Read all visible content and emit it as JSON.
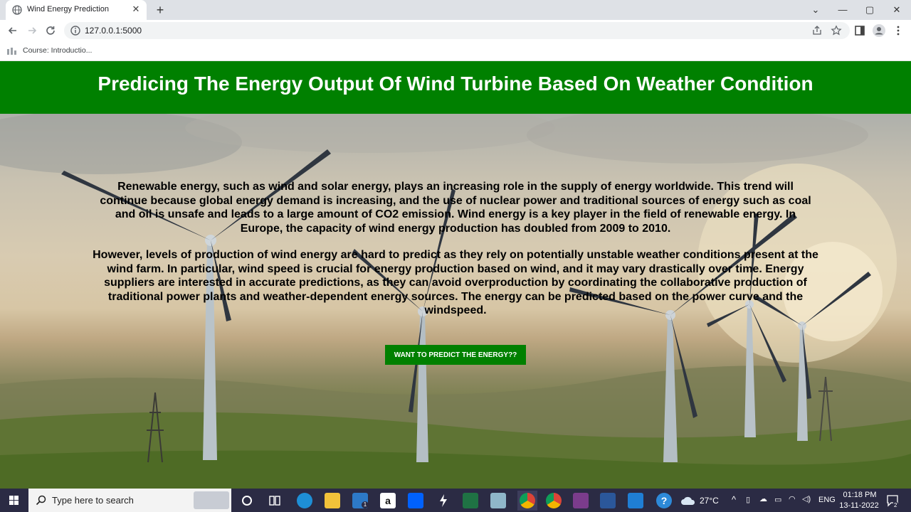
{
  "browser": {
    "tab_title": "Wind Energy Prediction",
    "url": "127.0.0.1:5000",
    "bookmark": "Course: Introductio..."
  },
  "page": {
    "title": "Predicing The Energy Output Of Wind Turbine Based On Weather Condition",
    "paragraph1": "Renewable energy, such as wind and solar energy, plays an increasing role in the supply of energy worldwide. This trend will continue because global energy demand is increasing, and the use of nuclear power and traditional sources of energy such as coal and oil is unsafe and leads to a large amount of CO2 emission. Wind energy is a key player in the field of renewable energy. In Europe, the capacity of wind energy production has doubled from 2009 to 2010.",
    "paragraph2": "However, levels of production of wind energy are hard to predict as they rely on potentially unstable weather conditions present at the wind farm. In particular, wind speed is crucial for energy production based on wind, and it may vary drastically over time. Energy suppliers are interested in accurate predictions, as they can avoid overproduction by coordinating the collaborative production of traditional power plants and weather-dependent energy sources. The energy can be predicted based on the power curve and the windspeed.",
    "cta_label": "WANT TO PREDICT THE ENERGY??"
  },
  "taskbar": {
    "search_placeholder": "Type here to search",
    "temperature": "27°C",
    "language": "ENG",
    "time": "01:18 PM",
    "date": "13-11-2022",
    "notification_count": "2",
    "mail_badge": "1"
  },
  "colors": {
    "header_green": "#008000",
    "taskbar": "#2b2b44"
  }
}
